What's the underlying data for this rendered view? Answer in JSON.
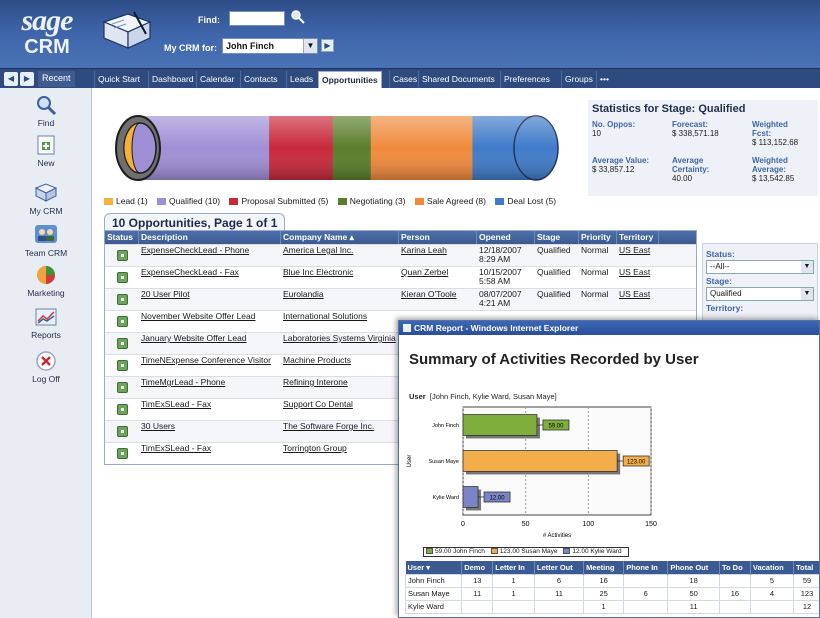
{
  "header": {
    "logo_line1": "sage",
    "logo_line2": "CRM",
    "find_label": "Find:",
    "find_value": "",
    "mycrm_label": "My CRM for:",
    "mycrm_value": "John Finch"
  },
  "tabbar": {
    "recent_label": "Recent",
    "tabs": [
      "Quick Start",
      "Dashboard",
      "Calendar",
      "Contacts",
      "Leads",
      "Opportunities",
      "Cases",
      "Shared Documents",
      "Preferences",
      "Groups",
      "•••"
    ],
    "active_tab": "Opportunities"
  },
  "sidebar": {
    "items": [
      "Find",
      "New",
      "My CRM",
      "Team CRM",
      "Marketing",
      "Reports",
      "Log Off"
    ]
  },
  "pipeline": {
    "legend": [
      {
        "label": "Lead (1)",
        "color": "#f4b13a"
      },
      {
        "label": "Qualified (10)",
        "color": "#9f8fd6"
      },
      {
        "label": "Proposal Submitted (5)",
        "color": "#c8283a"
      },
      {
        "label": "Negotiating (3)",
        "color": "#5a7d2a"
      },
      {
        "label": "Sale Agreed (8)",
        "color": "#f08a3c"
      },
      {
        "label": "Deal Lost (5)",
        "color": "#3f7bc9"
      }
    ]
  },
  "stats": {
    "title": "Statistics for Stage: Qualified",
    "no_oppos_label": "No. Oppos:",
    "no_oppos_value": "10",
    "forecast_label": "Forecast:",
    "forecast_value": "$ 338,571.18",
    "weighted_fcst_label1": "Weighted",
    "weighted_fcst_label2": "Fcst:",
    "weighted_fcst_value": "$ 113,152.68",
    "avg_value_label": "Average Value:",
    "avg_value_value": "$ 33,857.12",
    "avg_cert_label1": "Average",
    "avg_cert_label2": "Certainty:",
    "avg_cert_value": "40.00",
    "weighted_avg_label1": "Weighted",
    "weighted_avg_label2": "Average:",
    "weighted_avg_value": "$ 13,542.85"
  },
  "list": {
    "tab_title": "10 Opportunities, Page 1 of 1",
    "columns": [
      "Status",
      "Description",
      "Company Name ▴",
      "Person",
      "Opened",
      "Stage",
      "Priority",
      "Territory"
    ],
    "rows": [
      {
        "desc": "ExpenseCheckLead - Phone",
        "company": "America Legal Inc.",
        "person": "Karina Leah",
        "opened": "12/18/2007 8:29 AM",
        "stage": "Qualified",
        "priority": "Normal",
        "territory": "US East"
      },
      {
        "desc": "ExpenseCheckLead - Fax",
        "company": "Blue Inc Electronic",
        "person": "Quan Zerbel",
        "opened": "10/15/2007 5:58 AM",
        "stage": "Qualified",
        "priority": "Normal",
        "territory": "US East"
      },
      {
        "desc": "20 User Pilot",
        "company": "Eurolandia",
        "person": "Kieran O'Toole",
        "opened": "08/07/2007 4:21 AM",
        "stage": "Qualified",
        "priority": "Normal",
        "territory": "US East"
      },
      {
        "desc": "November Website Offer Lead",
        "company": "International Solutions",
        "person": "",
        "opened": "",
        "stage": "",
        "priority": "",
        "territory": ""
      },
      {
        "desc": "January Website Offer Lead",
        "company": "Laboratories Systems Virginia",
        "person": "",
        "opened": "",
        "stage": "",
        "priority": "",
        "territory": ""
      },
      {
        "desc": "TimeNExpense Conference Visitor",
        "company": "Machine Products",
        "person": "",
        "opened": "",
        "stage": "",
        "priority": "",
        "territory": ""
      },
      {
        "desc": "TimeMgrLead - Phone",
        "company": "Refining Interone",
        "person": "",
        "opened": "",
        "stage": "",
        "priority": "",
        "territory": ""
      },
      {
        "desc": "TimExSLead - Fax",
        "company": "Support Co Dental",
        "person": "",
        "opened": "",
        "stage": "",
        "priority": "",
        "territory": ""
      },
      {
        "desc": "30 Users",
        "company": "The Software Forge Inc.",
        "person": "",
        "opened": "",
        "stage": "",
        "priority": "",
        "territory": ""
      },
      {
        "desc": "TimExSLead - Fax",
        "company": "Torrington Group",
        "person": "",
        "opened": "",
        "stage": "",
        "priority": "",
        "territory": ""
      }
    ]
  },
  "filters": {
    "status_label": "Status:",
    "status_value": "--All--",
    "stage_label": "Stage:",
    "stage_value": "Qualified",
    "territory_label": "Territory:"
  },
  "popup": {
    "window_title": "CRM Report - Windows Internet Explorer",
    "report_title": "Summary of Activities Recorded by User",
    "user_label": "User",
    "user_value": "[John Finch, Kylie Ward, Susan Maye]",
    "table": {
      "columns": [
        "User ▾",
        "Demo",
        "Letter In",
        "Letter Out",
        "Meeting",
        "Phone In",
        "Phone Out",
        "To Do",
        "Vacation",
        "Total"
      ],
      "rows": [
        [
          "John Finch",
          "13",
          "1",
          "6",
          "16",
          "",
          "18",
          "",
          "5",
          "59"
        ],
        [
          "Susan Maye",
          "11",
          "1",
          "11",
          "25",
          "6",
          "50",
          "16",
          "4",
          "123"
        ],
        [
          "Kylie Ward",
          "",
          "",
          "",
          "1",
          "",
          "11",
          "",
          "",
          "12"
        ]
      ]
    }
  },
  "chart_data": {
    "type": "bar",
    "orientation": "horizontal",
    "title": "",
    "xlabel": "# Activities",
    "ylabel": "User",
    "categories": [
      "John Finch",
      "Susan Maye",
      "Kylie Ward"
    ],
    "values": [
      59,
      123,
      12
    ],
    "data_labels": [
      "59.00",
      "123.00",
      "12.00"
    ],
    "colors": [
      "#7fae3c",
      "#f3ad4a",
      "#7a84c6"
    ],
    "legend": [
      "59.00 John Finch",
      "123.00 Susan Maye",
      "12.00 Kylie Ward"
    ],
    "xlim": [
      0,
      150
    ],
    "xticks": [
      0,
      50,
      100,
      150
    ],
    "grid": true,
    "legend_position": "bottom"
  }
}
